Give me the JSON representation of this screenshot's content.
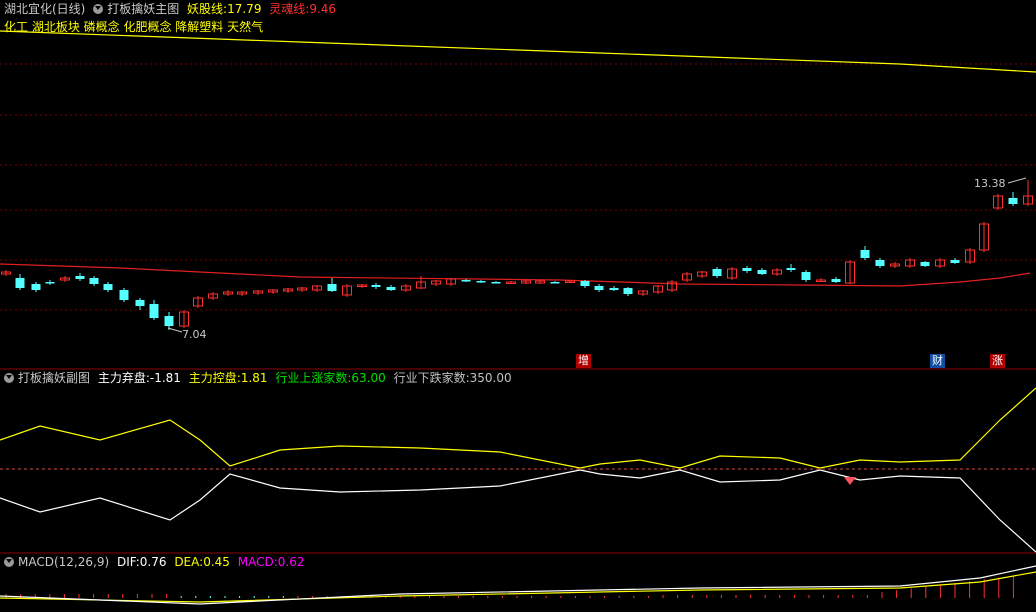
{
  "main_panel": {
    "title": "湖北宜化(日线)",
    "indicator_name": "打板擒妖主图",
    "lines": [
      {
        "label": "妖股线:",
        "value": "17.79",
        "color": "#ffff00"
      },
      {
        "label": "灵魂线:",
        "value": "9.46",
        "color": "#ff3030"
      }
    ],
    "sectors": "化工 湖北板块 磷概念 化肥概念 降解塑料 天然气",
    "high_label": "13.38",
    "low_label": "7.04",
    "event_markers": [
      {
        "text": "增",
        "bg": "#b00000"
      },
      {
        "text": "财",
        "bg": "#1050a0"
      },
      {
        "text": "涨",
        "bg": "#b00000"
      }
    ]
  },
  "sub_panel": {
    "indicator_name": "打板擒妖副图",
    "items": [
      {
        "label": "主力弃盘:",
        "value": "-1.81",
        "color": "#ffffff"
      },
      {
        "label": "主力控盘:",
        "value": "1.81",
        "color": "#ffff00"
      },
      {
        "label": "行业上涨家数:",
        "value": "63.00",
        "color": "#00e000"
      },
      {
        "label": "行业下跌家数:",
        "value": "350.00",
        "color": "#c0c0c0"
      }
    ]
  },
  "macd_panel": {
    "indicator_name": "MACD(12,26,9)",
    "items": [
      {
        "label": "DIF:",
        "value": "0.76",
        "color": "#ffffff"
      },
      {
        "label": "DEA:",
        "value": "0.45",
        "color": "#ffff00"
      },
      {
        "label": "MACD:",
        "value": "0.62",
        "color": "#ff00ff"
      }
    ]
  },
  "colors": {
    "up": "#ff3030",
    "down": "#54ffff",
    "grid": "#7a0000",
    "separator": "#8a0000"
  }
}
